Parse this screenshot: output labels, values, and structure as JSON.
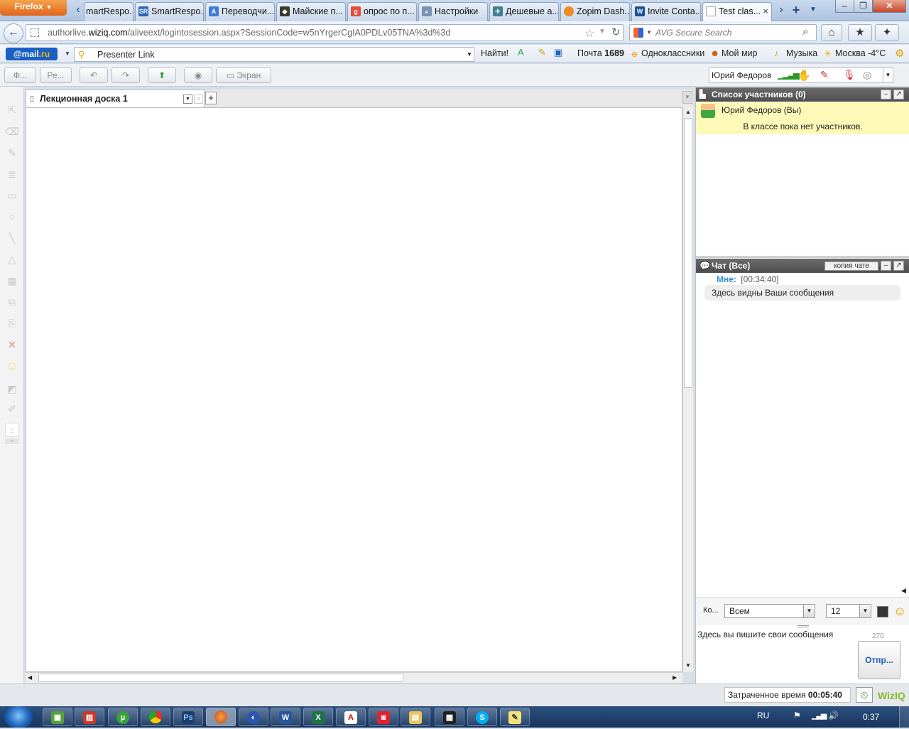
{
  "browser": {
    "menu_label": "Firefox",
    "tabs": [
      {
        "label": "martRespo...",
        "icon": "smartresponse-icon"
      },
      {
        "label": "SmartRespo...",
        "icon": "sr-icon"
      },
      {
        "label": "Переводчи...",
        "icon": "translator-icon"
      },
      {
        "label": "Майские п...",
        "icon": "bookmark-icon"
      },
      {
        "label": "опрос по п...",
        "icon": "google-icon"
      },
      {
        "label": "Настройки",
        "icon": "search-icon"
      },
      {
        "label": "Дешевые а...",
        "icon": "plane-icon"
      },
      {
        "label": "Zopim Dash...",
        "icon": "zopim-icon"
      },
      {
        "label": "Invite Conta...",
        "icon": "wiziq-icon"
      },
      {
        "label": "Test clas...",
        "icon": "page-icon"
      }
    ],
    "url_prefix": "authorlive.",
    "url_domain": "wiziq.com",
    "url_rest": "/aliveext/logintosession.aspx?SessionCode=w5nYrgerCgIA0PDLv05TNA%3d%3d",
    "search_placeholder": "AVG Secure Search"
  },
  "mailru": {
    "logo_at": "@mail",
    "logo_ru": ".ru",
    "search_value": "Presenter Link",
    "find_label": "Найти!",
    "mail_label": "Почта",
    "mail_count": "1689",
    "ok_label": "Одноклассники",
    "myworld_label": "Мой мир",
    "music_label": "Музыка",
    "weather_label": "Москва -4°C"
  },
  "app_toolbar": {
    "btn_f": "Ф...",
    "btn_re": "Ре...",
    "btn_screen": "Экран",
    "user_name": "Юрий Федоров"
  },
  "board": {
    "tab_title": "Лекционная доска 1",
    "add_tab": "+",
    "page_num": "2"
  },
  "participants": {
    "header": "Список участников (0)",
    "me": "Юрий Федоров (Вы)",
    "empty_message": "В классе пока нет участников."
  },
  "chat": {
    "header": "Чат (Все)",
    "copy_btn": "копия чате",
    "sender": "Мне:",
    "time": "[00:34:40]",
    "message": "Здесь видны Ваши сообщения",
    "to_label": "Ко...",
    "to_value": "Всем",
    "font_size": "12",
    "input_text": "Здесь вы пишите свои сообщения",
    "char_count": "270",
    "send_btn": "Отпр..."
  },
  "status": {
    "elapsed_label": "Затраченное время",
    "elapsed_value": "00:05:40",
    "brand": "WizIQ"
  },
  "taskbar": {
    "lang": "RU",
    "time": "0:37"
  },
  "colors": {
    "firefox_orange": "#e0641a",
    "mail_blue": "#1a5fc4",
    "panel_header": "#5a5a5a",
    "highlight_yellow": "#fdfab9",
    "chat_sender": "#2f8fd0"
  }
}
